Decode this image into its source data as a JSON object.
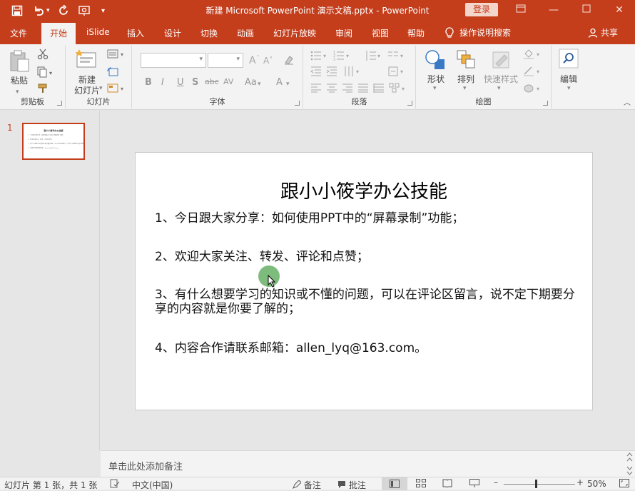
{
  "titlebar": {
    "title": "新建 Microsoft PowerPoint 演示文稿.pptx - PowerPoint",
    "login": "登录",
    "icons": [
      "save-icon",
      "undo-icon",
      "redo-icon",
      "present-icon",
      "customize-icon"
    ]
  },
  "tabs": [
    "文件",
    "开始",
    "iSlide",
    "插入",
    "设计",
    "切换",
    "动画",
    "幻灯片放映",
    "审阅",
    "视图",
    "帮助"
  ],
  "active_tab": "开始",
  "tell_me": "操作说明搜索",
  "share": "共享",
  "ribbon": {
    "clipboard": {
      "label": "剪贴板",
      "paste": "粘贴"
    },
    "slides": {
      "label": "幻灯片",
      "new_slide_line1": "新建",
      "new_slide_line2": "幻灯片"
    },
    "font": {
      "label": "字体",
      "buttons": [
        "B",
        "I",
        "U",
        "S",
        "abc",
        "AV",
        "Aa",
        "A"
      ]
    },
    "paragraph": {
      "label": "段落"
    },
    "drawing": {
      "label": "绘图",
      "shapes": "形状",
      "arrange": "排列",
      "quick_styles": "快速样式"
    },
    "editing": {
      "label": "编辑"
    }
  },
  "thumbnail": {
    "number": "1",
    "title": "跟小小筱学办公技能",
    "lines": [
      "1、今日跟大家分享：如何使用PPT中的“屏幕录制”功能；",
      "2、欢迎大家关注、转发、评论和点赞；",
      "3、有什么想要学习的知识或不懂的问题，可以在评论区留言，说不定下期要分享的内容就是你要了解的；",
      "4、内容合作请联系邮箱：allen_lyq@163.com。"
    ]
  },
  "slide": {
    "title": "跟小小筱学办公技能",
    "lines": [
      "1、今日跟大家分享：如何使用PPT中的“屏幕录制”功能；",
      "2、欢迎大家关注、转发、评论和点赞；",
      "3、有什么想要学习的知识或不懂的问题，可以在评论区留言，说不定下期要分享的内容就是你要了解的；",
      "4、内容合作请联系邮箱：allen_lyq@163.com。"
    ]
  },
  "notes": {
    "placeholder": "单击此处添加备注"
  },
  "status": {
    "slide_info": "幻灯片 第 1 张，共 1 张",
    "language": "中文(中国)",
    "notes": "备注",
    "comments": "批注",
    "zoom": "50%",
    "zoom_fraction": 0.5
  },
  "colors": {
    "accent": "#c43e1c",
    "ribbon_bg": "#f3f3f3",
    "canvas_bg": "#e6e6e6"
  }
}
